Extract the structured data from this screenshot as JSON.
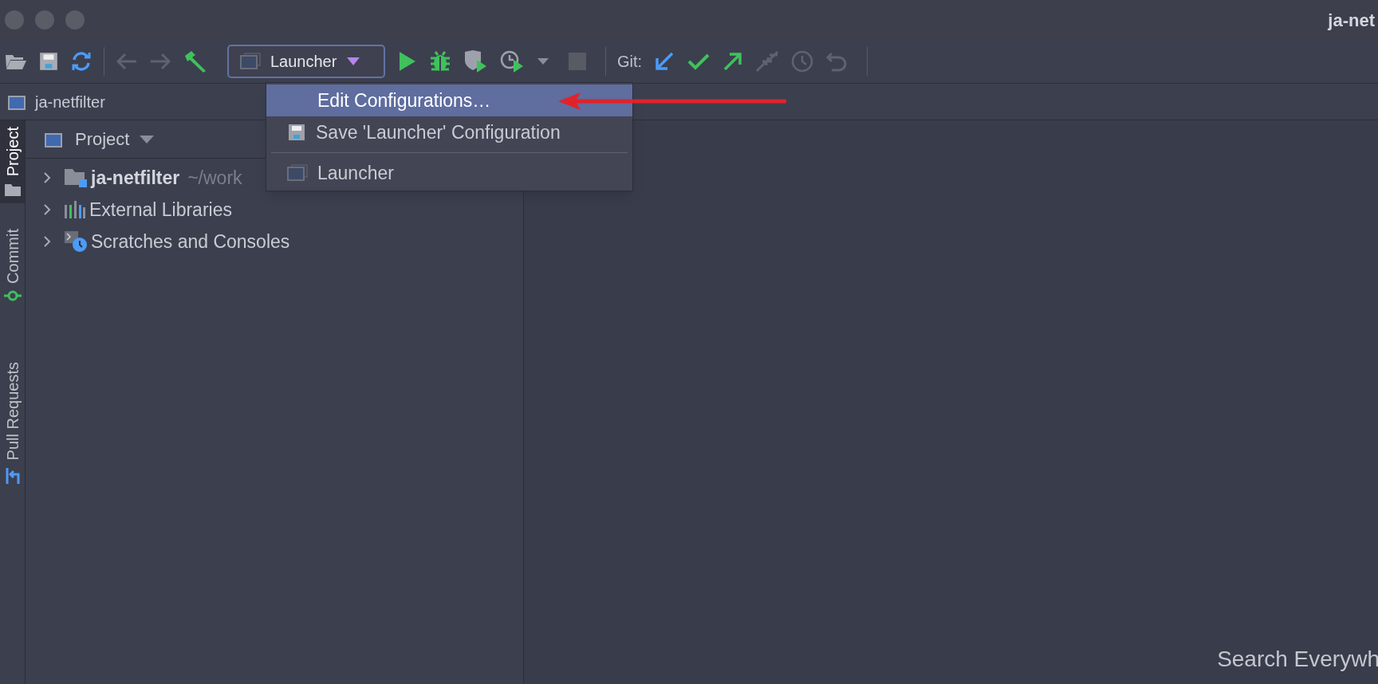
{
  "window": {
    "title": "ja-net"
  },
  "toolbar": {
    "run_config": "Launcher",
    "git_label": "Git:"
  },
  "run_menu": {
    "items": [
      {
        "kind": "edit",
        "label": "Edit Configurations…",
        "selected": true
      },
      {
        "kind": "save",
        "label": "Save 'Launcher' Configuration",
        "selected": false
      },
      {
        "kind": "separator"
      },
      {
        "kind": "config",
        "label": "Launcher",
        "selected": false
      }
    ]
  },
  "breadcrumb": "ja-netfilter",
  "side_tabs": [
    {
      "kind": "project",
      "label": "Project",
      "selected": true
    },
    {
      "kind": "commit",
      "label": "Commit",
      "selected": false
    },
    {
      "kind": "pull",
      "label": "Pull Requests",
      "selected": false
    }
  ],
  "project_panel": {
    "title": "Project",
    "tree": [
      {
        "kind": "module",
        "label": "ja-netfilter",
        "path": "~/work",
        "expanded": false
      },
      {
        "kind": "libraries",
        "label": "External Libraries",
        "expanded": false
      },
      {
        "kind": "scratches",
        "label": "Scratches and Consoles",
        "expanded": false
      }
    ]
  },
  "editor": {
    "hint": "Search Everywh"
  }
}
